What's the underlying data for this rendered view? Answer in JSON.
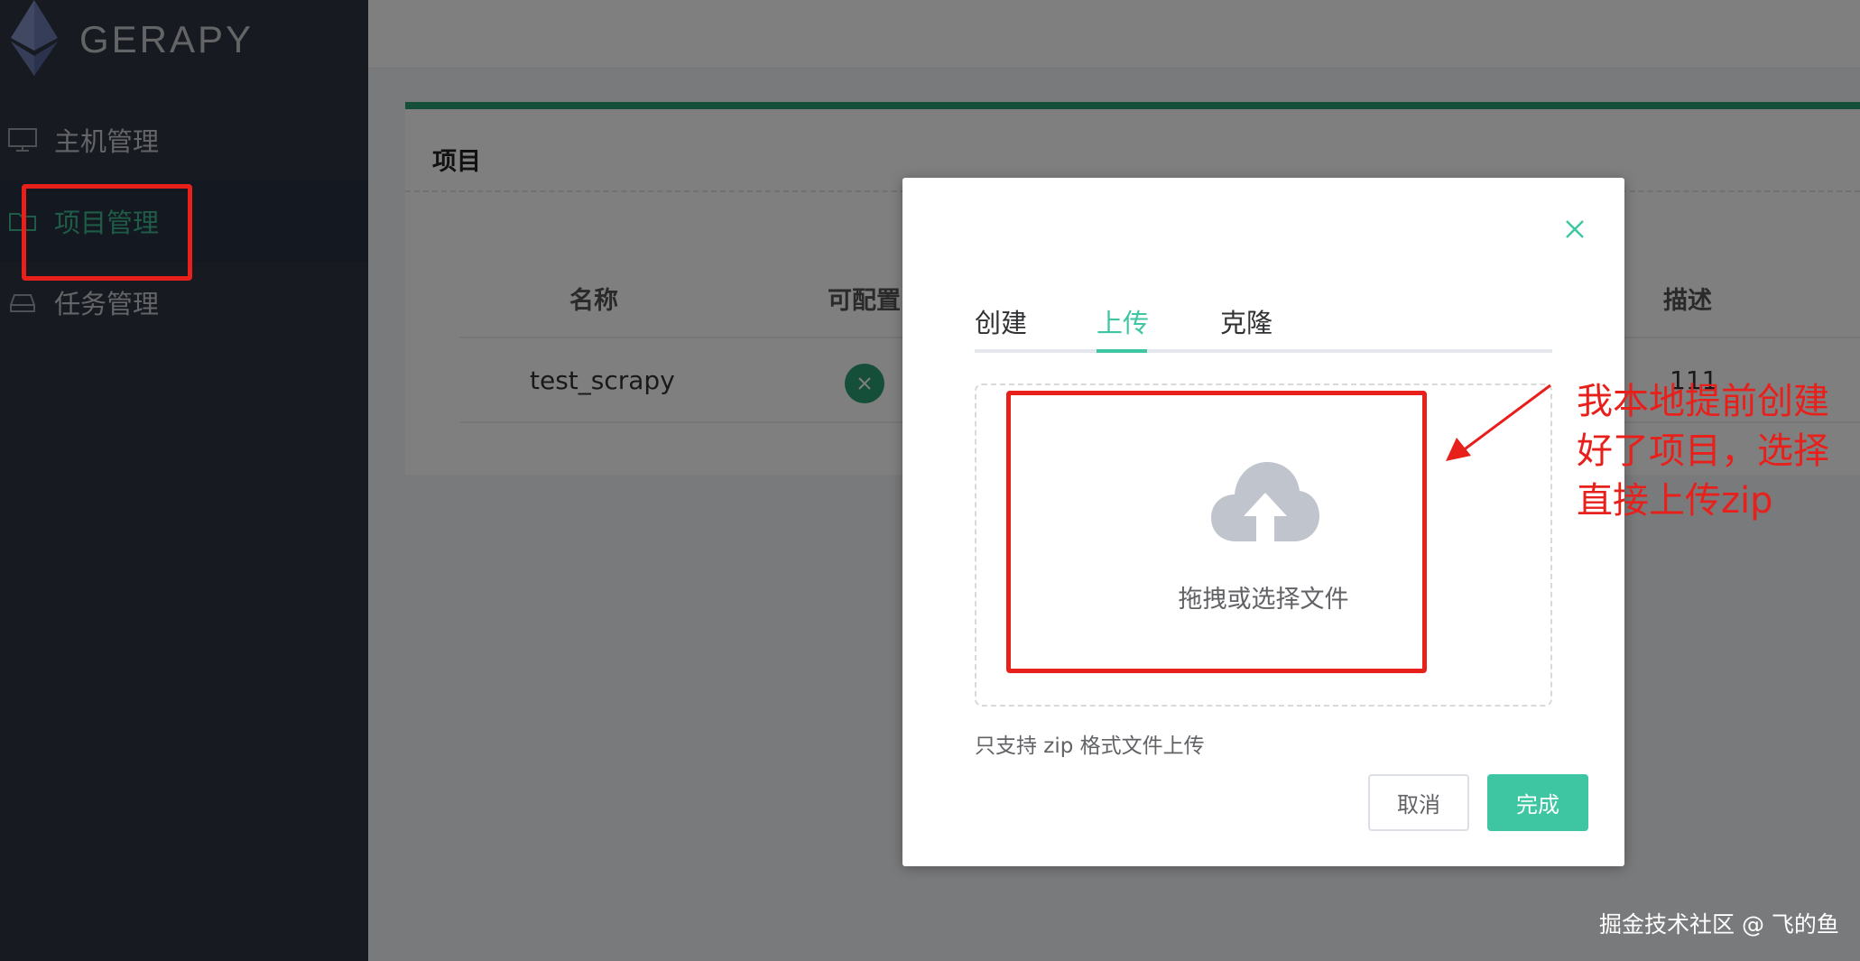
{
  "app": {
    "logo_text": "GERAPY"
  },
  "sidebar": {
    "items": [
      {
        "label": "主机管理",
        "icon": "monitor-icon"
      },
      {
        "label": "项目管理",
        "icon": "folder-icon",
        "active": true
      },
      {
        "label": "任务管理",
        "icon": "hard-drive-icon"
      }
    ]
  },
  "main": {
    "card_title": "项目",
    "table": {
      "headers": {
        "name": "名称",
        "configurable": "可配置",
        "description": "描述"
      },
      "rows": [
        {
          "name": "test_scrapy",
          "configurable_icon": "x-icon",
          "description": "111"
        }
      ]
    }
  },
  "dialog": {
    "tabs": [
      {
        "label": "创建"
      },
      {
        "label": "上传",
        "active": true
      },
      {
        "label": "克隆"
      }
    ],
    "dropzone_text": "拖拽或选择文件",
    "dropzone_icon": "cloud-upload-icon",
    "tip": "只支持 zip 格式文件上传",
    "cancel_label": "取消",
    "done_label": "完成"
  },
  "annotation": {
    "text_lines": [
      "我本地提前创建",
      "好了项目，选择",
      "直接上传zip"
    ],
    "color": "#e8201c"
  },
  "watermark": "掘金技术社区 @ 飞的鱼",
  "colors": {
    "sidebar_bg": "#2f3542",
    "accent": "#3ec6a3",
    "active_nav": "#3fb98f",
    "card_top": "#2a9e73"
  }
}
